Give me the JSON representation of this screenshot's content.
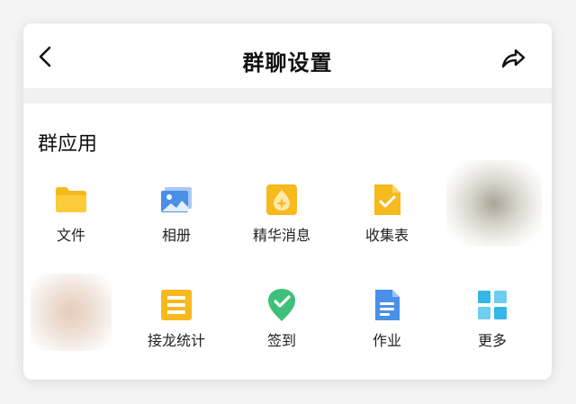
{
  "header": {
    "title": "群聊设置",
    "back_icon": "chevron-left-icon",
    "share_icon": "share-arrow-icon"
  },
  "section": {
    "title": "群应用"
  },
  "apps": [
    {
      "label": "文件",
      "icon": "folder-icon",
      "color": "#F7C22E"
    },
    {
      "label": "相册",
      "icon": "photo-album-icon",
      "color": "#4A8FE8"
    },
    {
      "label": "精华消息",
      "icon": "essence-message-icon",
      "color": "#F7C22E"
    },
    {
      "label": "收集表",
      "icon": "collection-form-icon",
      "color": "#F7C22E"
    },
    {
      "label": "接龙统计",
      "icon": "relay-stats-icon",
      "color": "#F7C22E"
    },
    {
      "label": "签到",
      "icon": "checkin-icon",
      "color": "#3CC07A"
    },
    {
      "label": "作业",
      "icon": "homework-icon",
      "color": "#4A8FE8"
    },
    {
      "label": "更多",
      "icon": "more-grid-icon",
      "color": "#35B6E8"
    }
  ]
}
